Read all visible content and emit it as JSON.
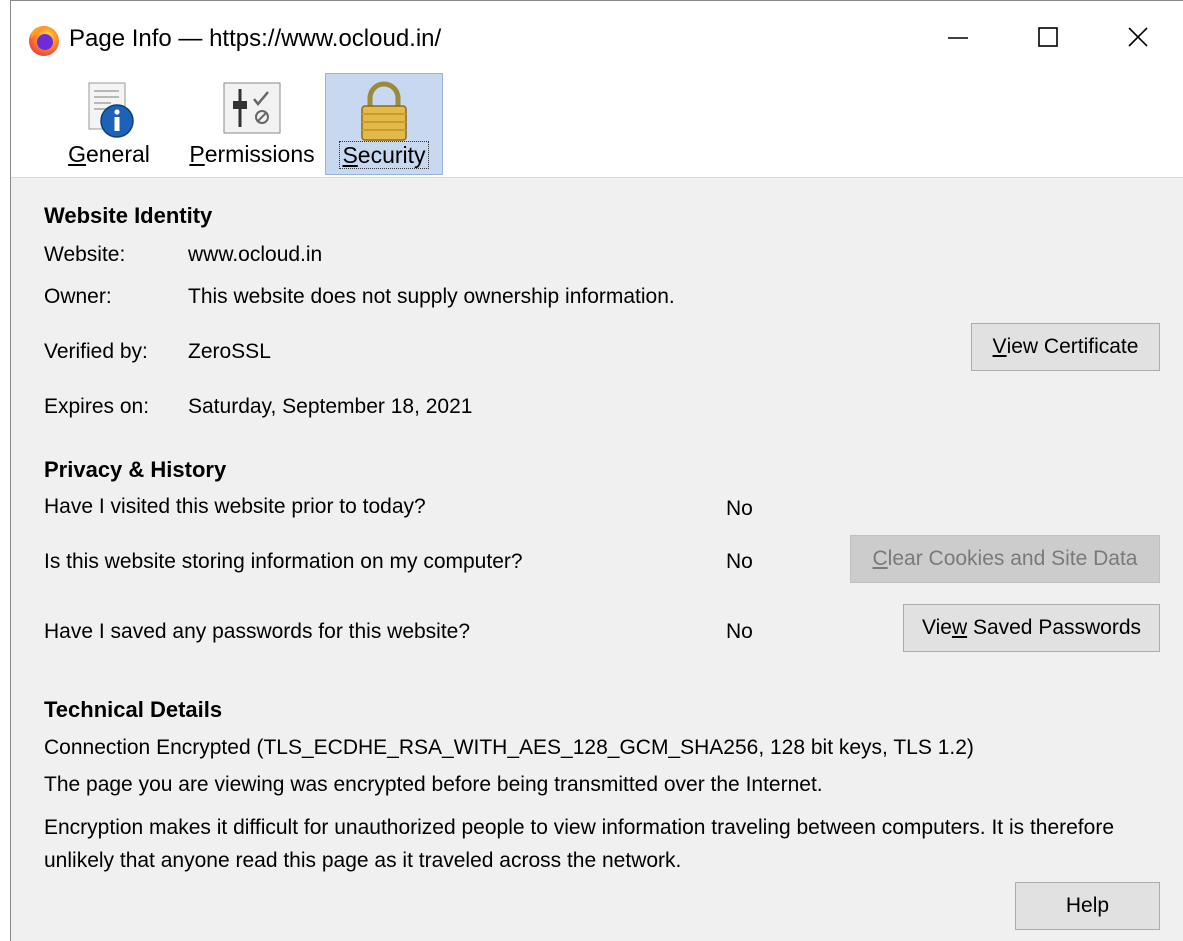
{
  "window": {
    "title": "Page Info — https://www.ocloud.in/",
    "app_icon": "firefox-icon",
    "controls": {
      "minimize": "minimize-icon",
      "maximize": "maximize-icon",
      "close": "close-icon"
    }
  },
  "tabs": [
    {
      "label": "General",
      "mnemonic": "G",
      "icon": "info-document-icon",
      "selected": false
    },
    {
      "label": "Permissions",
      "mnemonic": "P",
      "icon": "permissions-sliders-icon",
      "selected": false
    },
    {
      "label": "Security",
      "mnemonic": "S",
      "icon": "padlock-icon",
      "selected": true
    }
  ],
  "identity": {
    "heading": "Website Identity",
    "website_label": "Website:",
    "website_value": "www.ocloud.in",
    "owner_label": "Owner:",
    "owner_value": "This website does not supply ownership information.",
    "verified_label": "Verified by:",
    "verified_value": "ZeroSSL",
    "expires_label": "Expires on:",
    "expires_value": "Saturday, September 18, 2021",
    "view_certificate_button": "View Certificate"
  },
  "privacy": {
    "heading": "Privacy & History",
    "visited_question": "Have I visited this website prior to today?",
    "visited_answer": "No",
    "storing_question": "Is this website storing information on my computer?",
    "storing_answer": "No",
    "clear_button": "Clear Cookies and Site Data",
    "passwords_question": "Have I saved any passwords for this website?",
    "passwords_answer": "No",
    "view_passwords_button": "View Saved Passwords"
  },
  "technical": {
    "heading": "Technical Details",
    "line1": "Connection Encrypted (TLS_ECDHE_RSA_WITH_AES_128_GCM_SHA256, 128 bit keys, TLS 1.2)",
    "line2": "The page you are viewing was encrypted before being transmitted over the Internet.",
    "line3": "Encryption makes it difficult for unauthorized people to view information traveling between computers. It is therefore unlikely that anyone read this page as it traveled across the network."
  },
  "help_button": "Help",
  "colors": {
    "selected_tab_bg": "#c7d8f0",
    "dialog_bg": "#f0f0f0",
    "button_bg": "#e1e1e1"
  }
}
